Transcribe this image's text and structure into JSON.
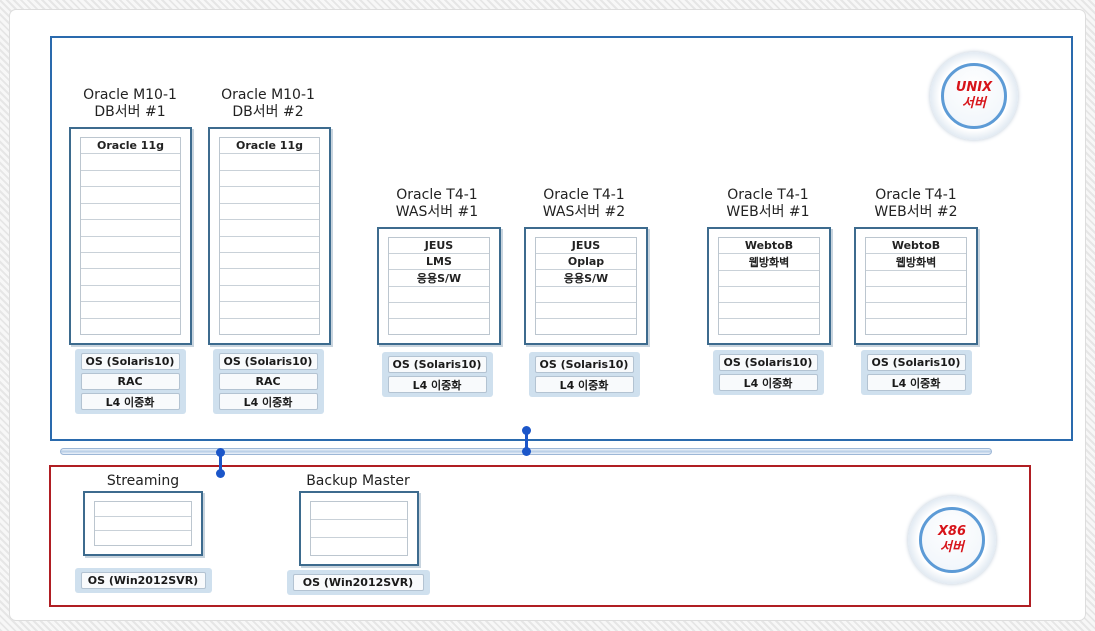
{
  "unix": {
    "badge": [
      "UNIX",
      "서버"
    ],
    "servers": [
      {
        "title": [
          "Oracle M10-1",
          "DB서버 #1"
        ],
        "rows": [
          "Oracle 11g",
          "",
          "",
          "",
          "",
          "",
          "",
          "",
          "",
          "",
          "",
          ""
        ],
        "tags": [
          "OS (Solaris10)",
          "RAC",
          "L4 이중화"
        ]
      },
      {
        "title": [
          "Oracle M10-1",
          "DB서버 #2"
        ],
        "rows": [
          "Oracle 11g",
          "",
          "",
          "",
          "",
          "",
          "",
          "",
          "",
          "",
          "",
          ""
        ],
        "tags": [
          "OS (Solaris10)",
          "RAC",
          "L4 이중화"
        ]
      },
      {
        "title": [
          "Oracle T4-1",
          "WAS서버 #1"
        ],
        "rows": [
          "JEUS",
          "LMS",
          "응용S/W",
          "",
          "",
          ""
        ],
        "tags": [
          "OS (Solaris10)",
          "L4 이중화"
        ]
      },
      {
        "title": [
          "Oracle T4-1",
          "WAS서버 #2"
        ],
        "rows": [
          "JEUS",
          "Oplap",
          "응용S/W",
          "",
          "",
          ""
        ],
        "tags": [
          "OS (Solaris10)",
          "L4 이중화"
        ]
      },
      {
        "title": [
          "Oracle T4-1",
          "WEB서버 #1"
        ],
        "rows": [
          "WebtoB",
          "웹방화벽",
          "",
          "",
          "",
          ""
        ],
        "tags": [
          "OS (Solaris10)",
          "L4 이중화"
        ]
      },
      {
        "title": [
          "Oracle T4-1",
          "WEB서버 #2"
        ],
        "rows": [
          "WebtoB",
          "웹방화벽",
          "",
          "",
          "",
          ""
        ],
        "tags": [
          "OS (Solaris10)",
          "L4 이중화"
        ]
      }
    ]
  },
  "x86": {
    "badge": [
      "X86",
      "서버"
    ],
    "servers": [
      {
        "title": [
          "Streaming"
        ],
        "rows": [
          "",
          "",
          ""
        ],
        "tags": [
          "OS (Win2012SVR)"
        ]
      },
      {
        "title": [
          "Backup Master"
        ],
        "rows": [
          "",
          "",
          ""
        ],
        "tags": [
          "OS (Win2012SVR)"
        ]
      }
    ]
  }
}
